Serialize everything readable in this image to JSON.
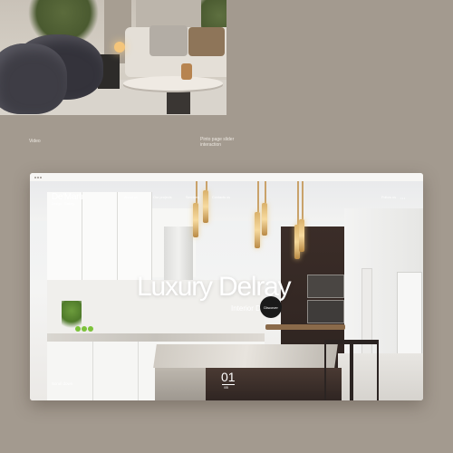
{
  "captions": {
    "left": "Video",
    "right": "Pinto page slider interaction"
  },
  "site": {
    "logo": "De'Marti",
    "logo_sub": "Design · Gallery",
    "nav": [
      "About us",
      "Our projects",
      "Services",
      "Contacts us"
    ],
    "follow": "Follow us",
    "menu_glyph": "•••",
    "hero_title": "Luxury Delray",
    "hero_subtitle": "Interior Design",
    "discover_label": "Discover",
    "scroll_label": "Scroll down",
    "slide_number": "01",
    "slide_total": "/05"
  },
  "colors": {
    "background": "#a39a8f",
    "discover_button": "#1a1a1a"
  }
}
